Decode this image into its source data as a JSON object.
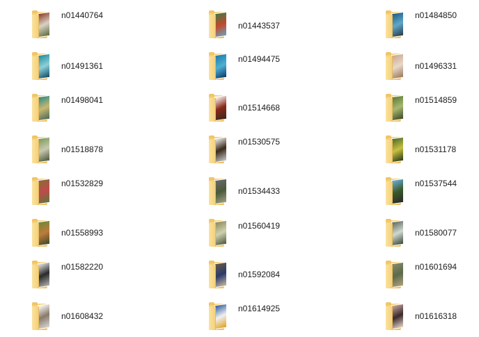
{
  "items": [
    {
      "name": "n01440764",
      "thumb": [
        "#8a3a2a",
        "#d9d2c4",
        "#5a6a3a"
      ]
    },
    {
      "name": "n01443537",
      "thumb": [
        "#3f7a4a",
        "#c04a2a",
        "#6aa0c0"
      ]
    },
    {
      "name": "n01484850",
      "thumb": [
        "#1e5a8a",
        "#5fa8c8",
        "#2a3a4a"
      ]
    },
    {
      "name": "n01491361",
      "thumb": [
        "#1f8aa0",
        "#8fd0d8",
        "#0f4a6a"
      ]
    },
    {
      "name": "n01494475",
      "thumb": [
        "#1a7ab0",
        "#50b0d0",
        "#0a3a70"
      ]
    },
    {
      "name": "n01496331",
      "thumb": [
        "#c8a890",
        "#e8d8c8",
        "#9a7860"
      ]
    },
    {
      "name": "n01498041",
      "thumb": [
        "#2a8a8a",
        "#c8b870",
        "#4a6a5a"
      ]
    },
    {
      "name": "n01514668",
      "thumb": [
        "#ffffff",
        "#8a2a1a",
        "#3a2a1a"
      ]
    },
    {
      "name": "n01514859",
      "thumb": [
        "#5a7a3a",
        "#a8b870",
        "#3a4a2a"
      ]
    },
    {
      "name": "n01518878",
      "thumb": [
        "#7a9a5a",
        "#c8c8b0",
        "#4a5a3a"
      ]
    },
    {
      "name": "n01530575",
      "thumb": [
        "#f0f0f0",
        "#3a2a1a",
        "#c8c8c8"
      ]
    },
    {
      "name": "n01531178",
      "thumb": [
        "#4a6a2a",
        "#c8c040",
        "#2a3a1a"
      ]
    },
    {
      "name": "n01532829",
      "thumb": [
        "#8a6a3a",
        "#c04a4a",
        "#5a7a3a"
      ]
    },
    {
      "name": "n01534433",
      "thumb": [
        "#6a6a6a",
        "#4a5a3a",
        "#a0a080"
      ]
    },
    {
      "name": "n01537544",
      "thumb": [
        "#6ab0e0",
        "#3a5a2a",
        "#2a2a2a"
      ]
    },
    {
      "name": "n01558993",
      "thumb": [
        "#6a8a3a",
        "#c07a3a",
        "#3a4a2a"
      ]
    },
    {
      "name": "n01560419",
      "thumb": [
        "#8a8a5a",
        "#d0d0b0",
        "#4a5a3a"
      ]
    },
    {
      "name": "n01580077",
      "thumb": [
        "#5a6a5a",
        "#d0d8d0",
        "#3a4a3a"
      ]
    },
    {
      "name": "n01582220",
      "thumb": [
        "#e8e8e8",
        "#2a2a2a",
        "#b0b0b0"
      ]
    },
    {
      "name": "n01592084",
      "thumb": [
        "#6a5a4a",
        "#2a3a6a",
        "#c8b8a0"
      ]
    },
    {
      "name": "n01601694",
      "thumb": [
        "#8a8a6a",
        "#5a6a4a",
        "#b0a080"
      ]
    },
    {
      "name": "n01608432",
      "thumb": [
        "#ffffff",
        "#8a7a6a",
        "#d8d8d8"
      ]
    },
    {
      "name": "n01614925",
      "thumb": [
        "#2a5aa0",
        "#f0f0f0",
        "#e0a020"
      ]
    },
    {
      "name": "n01616318",
      "thumb": [
        "#c8a8a0",
        "#3a2a2a",
        "#e8d8d0"
      ]
    }
  ]
}
